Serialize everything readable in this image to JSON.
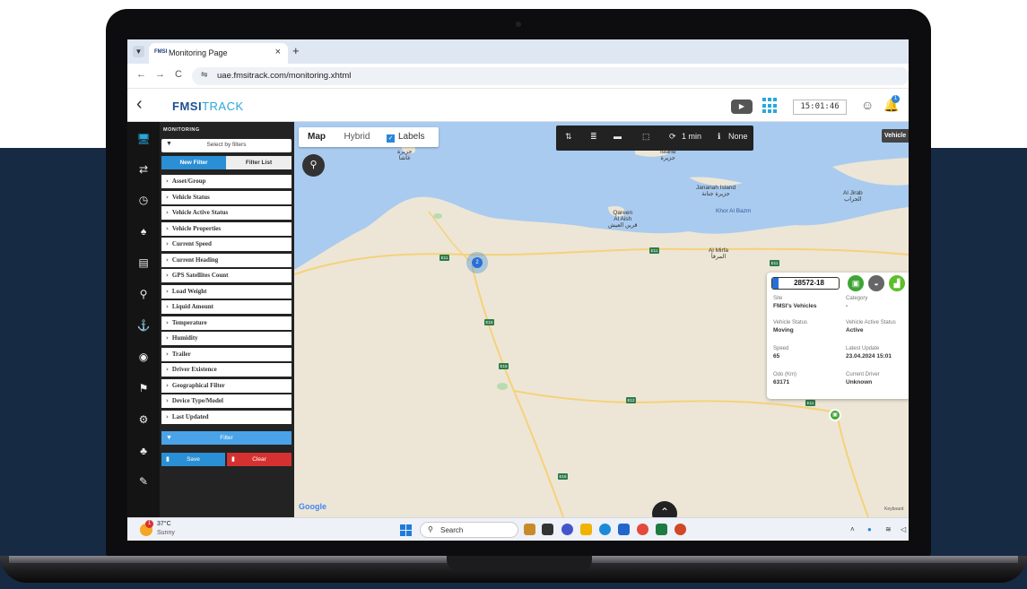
{
  "browser": {
    "tab_title": "Monitoring Page",
    "tab_favicon": "FMSI",
    "url": "uae.fmsitrack.com/monitoring.xhtml"
  },
  "app": {
    "logo_part1": "FMSI",
    "logo_part2": "TRACK",
    "clock": "15:01:46",
    "bell_count": "1"
  },
  "panel": {
    "title": "MONITORING",
    "select_placeholder": "Select by filters",
    "tab_new": "New Filter",
    "tab_list": "Filter List",
    "filters": [
      "Asset/Group",
      "Vehicle Status",
      "Vehicle Active Status",
      "Vehicle Properties",
      "Current Speed",
      "Current Heading",
      "GPS Satellites Count",
      "Load Weight",
      "Liquid Amount",
      "Temperature",
      "Humidity",
      "Trailer",
      "Driver Existence",
      "Geographical Filter",
      "Device Type/Model",
      "Last Updated"
    ],
    "filter_button": "Filter",
    "save_button": "Save",
    "clear_button": "Clear"
  },
  "map": {
    "type_map": "Map",
    "type_hybrid": "Hybrid",
    "labels_toggle": "Labels",
    "refresh_interval": "1 min",
    "info_mode": "None",
    "vehicle_tab": "Vehicle",
    "cluster_count": "2",
    "google": "Google",
    "keyboard": "Keyboard",
    "places": {
      "island": "Island\nجزيرة",
      "ghasha": "جزيرة\nغاشا",
      "jananah": "Jananah Island\nجزيرة جنانة",
      "khor": "Khor Al Bazm",
      "qareen": "Qareen\nAl Aish\nقرين العيش",
      "mirfa": "Al Mirfa\nالمرفأ",
      "jirab": "Al Jirab\nالجراب"
    },
    "roads": [
      "E11",
      "E11",
      "E11",
      "E15",
      "E15",
      "E15",
      "E12",
      "E11",
      "E15"
    ]
  },
  "vehicle": {
    "plate": "28572-18",
    "fields": {
      "site_label": "Site",
      "site_value": "FMSI's Vehicles",
      "category_label": "Category",
      "category_value": "-",
      "status_label": "Vehicle Status",
      "status_value": "Moving",
      "active_label": "Vehicle Active Status",
      "active_value": "Active",
      "speed_label": "Speed",
      "speed_value": "65",
      "update_label": "Latest Update",
      "update_value": "23.04.2024 15:01",
      "odo_label": "Odo (Km)",
      "odo_value": "63171",
      "driver_label": "Current Driver",
      "driver_value": "Unknown"
    }
  },
  "taskbar": {
    "temperature": "37°C",
    "weather": "Sunny",
    "weather_badge": "1",
    "search": "Search"
  }
}
